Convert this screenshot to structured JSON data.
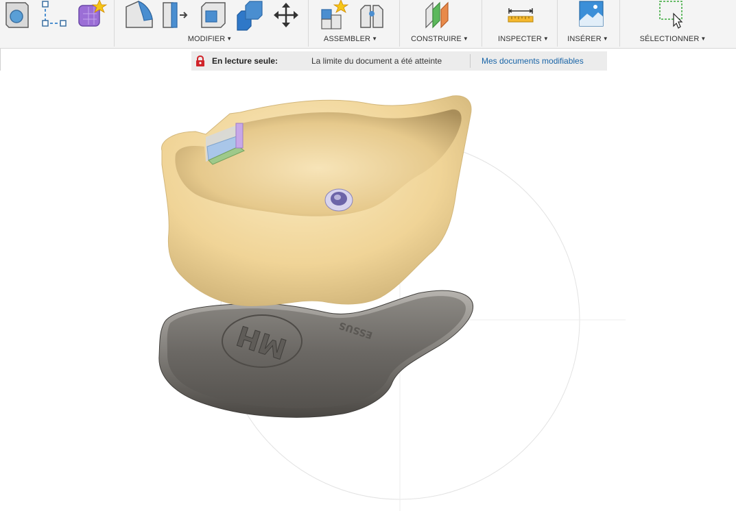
{
  "toolbar": {
    "groups": [
      {
        "label": "MODIFIER",
        "icons": [
          "press-pull-icon",
          "fillet-icon",
          "shell-icon",
          "combine-icon",
          "move-icon"
        ]
      },
      {
        "label": "ASSEMBLER",
        "icons": [
          "new-component-icon",
          "joint-icon"
        ]
      },
      {
        "label": "CONSTRUIRE",
        "icons": [
          "offset-plane-icon"
        ]
      },
      {
        "label": "INSPECTER",
        "icons": [
          "measure-icon"
        ]
      },
      {
        "label": "INSÉRER",
        "icons": [
          "insert-image-icon"
        ]
      },
      {
        "label": "SÉLECTIONNER",
        "icons": [
          "select-window-icon"
        ]
      }
    ],
    "create_icons": [
      "box-icon",
      "sketch-icon",
      "form-icon"
    ],
    "caret": "▼"
  },
  "readonly_bar": {
    "title": "En lecture seule:",
    "message": "La limite du document a été atteinte",
    "link": "Mes documents modifiables"
  },
  "model": {
    "base_text": "MH",
    "base_text_small": "ESSUS"
  },
  "colors": {
    "toolbar_bg": "#f4f4f4",
    "model_body": "#f2d69a",
    "base_plate": "#6d6a66",
    "link": "#1763a6",
    "lock": "#d0242a"
  }
}
